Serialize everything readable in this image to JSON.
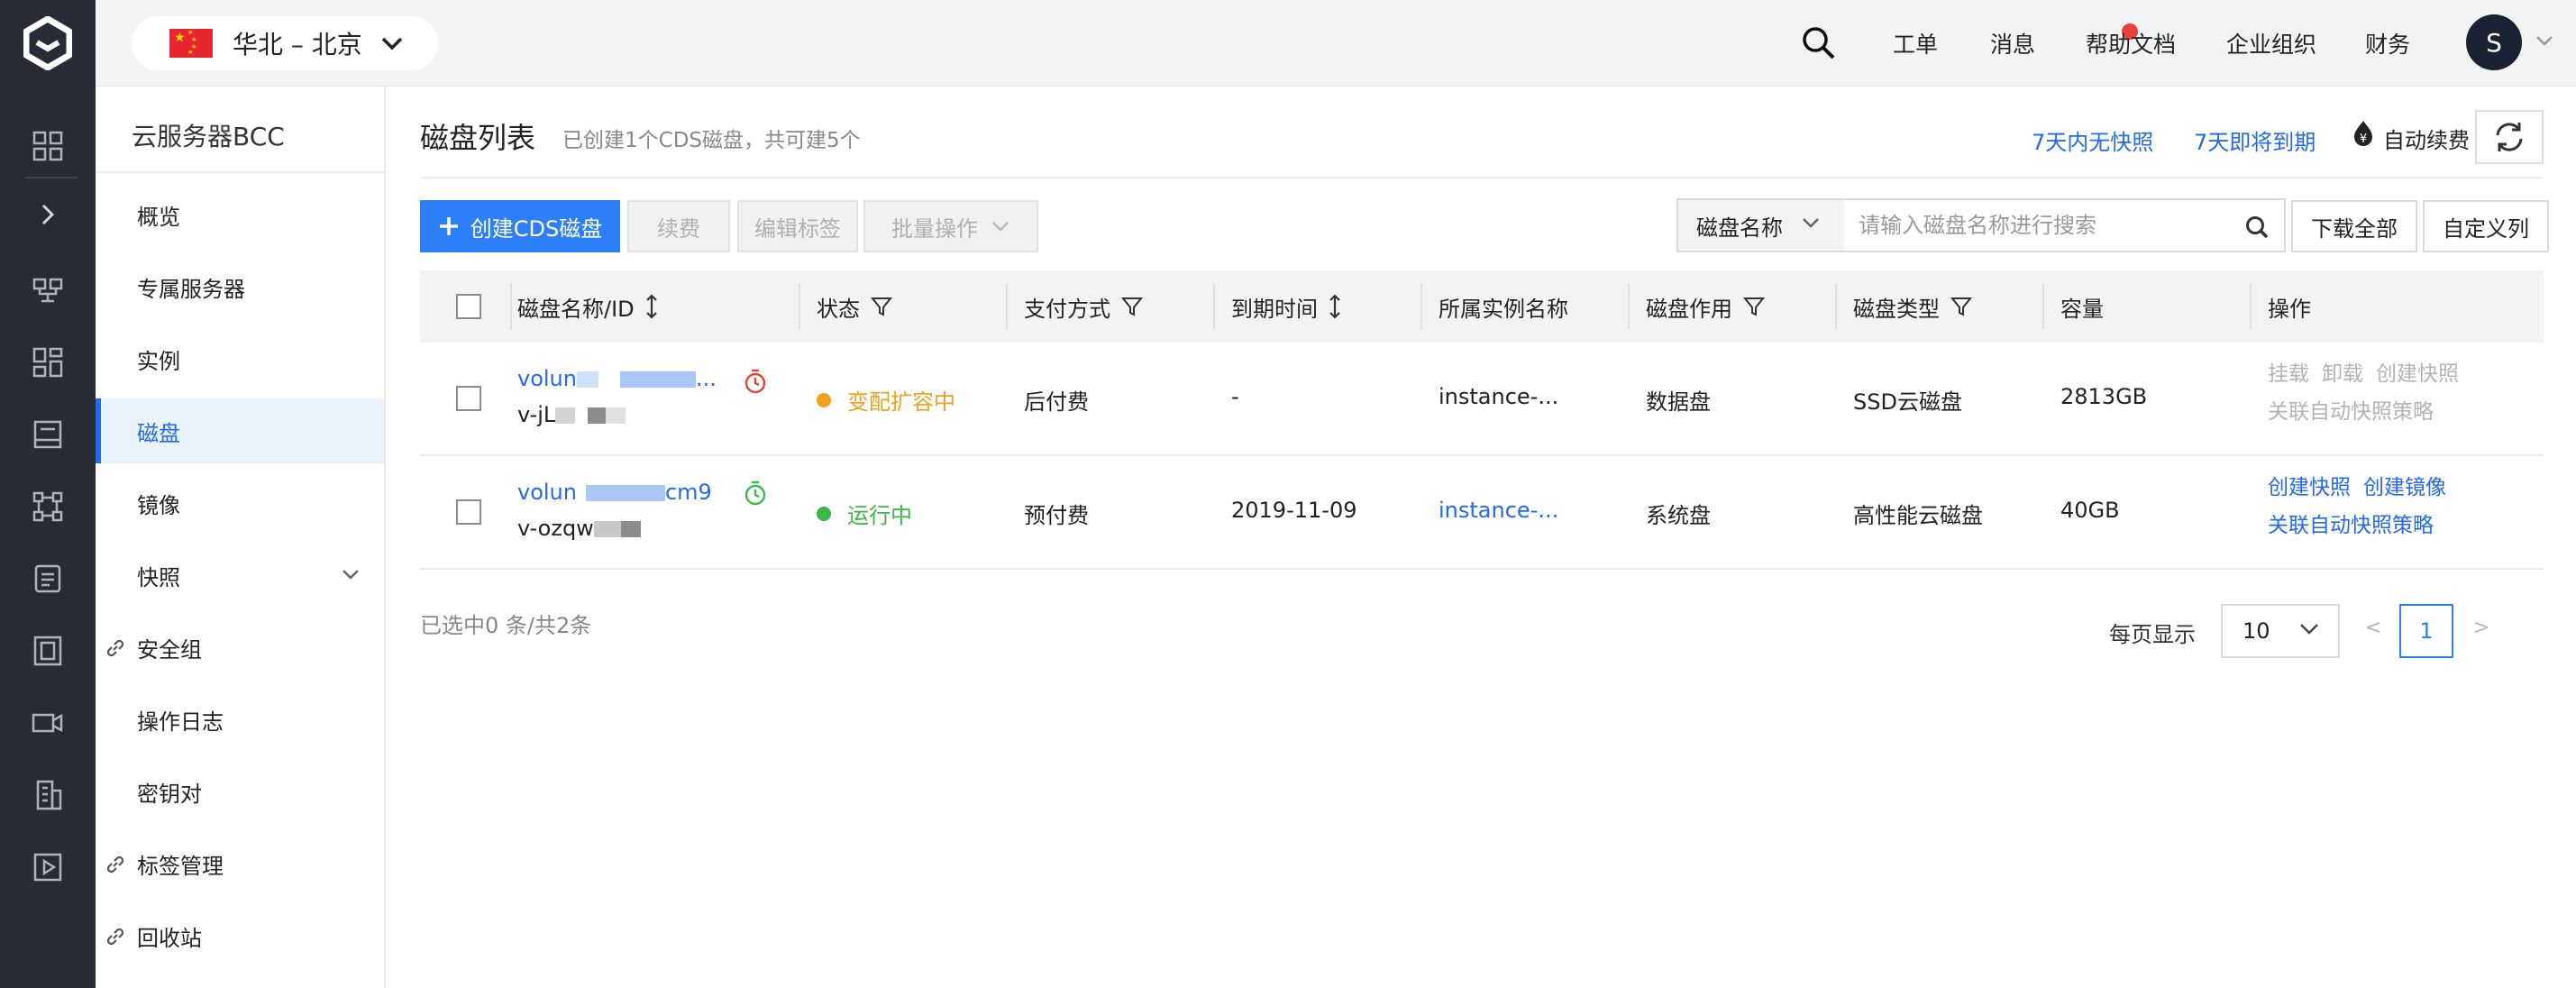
{
  "rail": {
    "items": [
      {
        "icon": "dashboard-icon"
      },
      {
        "icon": "expand-arrow-icon"
      },
      {
        "icon": "network-icon"
      },
      {
        "icon": "grid-icon"
      },
      {
        "icon": "storage-icon"
      },
      {
        "icon": "nodes-icon"
      },
      {
        "icon": "database-icon"
      },
      {
        "icon": "building-icon"
      },
      {
        "icon": "video-camera-icon"
      },
      {
        "icon": "office-icon"
      },
      {
        "icon": "play-icon"
      }
    ]
  },
  "topbar": {
    "region": "华北 – 北京",
    "links": {
      "ticket": "工单",
      "messages": "消息",
      "help": "帮助文档",
      "org": "企业组织",
      "finance": "财务"
    },
    "avatar": "S",
    "colors": {
      "badge": "#e8413c",
      "avatar": "#1a2233"
    }
  },
  "sidenav": {
    "title": "云服务器BCC",
    "items": [
      {
        "label": "概览"
      },
      {
        "label": "专属服务器"
      },
      {
        "label": "实例"
      },
      {
        "label": "磁盘"
      },
      {
        "label": "镜像"
      },
      {
        "label": "快照"
      },
      {
        "label": "安全组"
      },
      {
        "label": "操作日志"
      },
      {
        "label": "密钥对"
      },
      {
        "label": "标签管理"
      },
      {
        "label": "回收站"
      }
    ],
    "active": "磁盘"
  },
  "main": {
    "title": "磁盘列表",
    "subtitle": "已创建1个CDS磁盘，共可建5个",
    "links": {
      "no_snapshot": "7天内无快照",
      "expiring": "7天即将到期",
      "auto_renew": "自动续费"
    },
    "toolbar": {
      "create": "创建CDS磁盘",
      "renew": "续费",
      "edit_tags": "编辑标签",
      "batch": "批量操作",
      "search_field": "磁盘名称",
      "search_placeholder": "请输入磁盘名称进行搜索",
      "download_all": "下载全部",
      "custom_columns": "自定义列"
    },
    "table": {
      "headers": {
        "name_id": "磁盘名称/ID",
        "status": "状态",
        "payment": "支付方式",
        "expire": "到期时间",
        "instance": "所属实例名称",
        "usage": "磁盘作用",
        "type": "磁盘类型",
        "capacity": "容量",
        "actions": "操作"
      },
      "rows": [
        {
          "name_prefix": "volun",
          "name_suffix": "...",
          "id_prefix": "v-jL",
          "status": "变配扩容中",
          "status_color": "#f0a020",
          "payment": "后付费",
          "expire": "-",
          "instance": "instance-...",
          "usage": "数据盘",
          "type": "SSD云磁盘",
          "capacity": "2813GB",
          "ops1": [
            "挂载",
            "卸载",
            "创建快照"
          ],
          "ops2": [
            "关联自动快照策略"
          ]
        },
        {
          "name_prefix": "volun",
          "name_suffix": "cm9",
          "id_prefix": "v-ozqw",
          "status": "运行中",
          "status_color": "#3cb84a",
          "payment": "预付费",
          "expire": "2019-11-09",
          "instance": "instance-...",
          "usage": "系统盘",
          "type": "高性能云磁盘",
          "capacity": "40GB",
          "ops1": [
            "创建快照",
            "创建镜像"
          ],
          "ops2": [
            "关联自动快照策略"
          ]
        }
      ]
    },
    "footer": {
      "selected": "已选中0 条/共2条",
      "per_page_label": "每页显示",
      "per_page": "10",
      "prev": "<",
      "page": "1",
      "next": ">"
    },
    "colors": {
      "primary": "#2d7ff9",
      "link": "#2468f2"
    }
  }
}
